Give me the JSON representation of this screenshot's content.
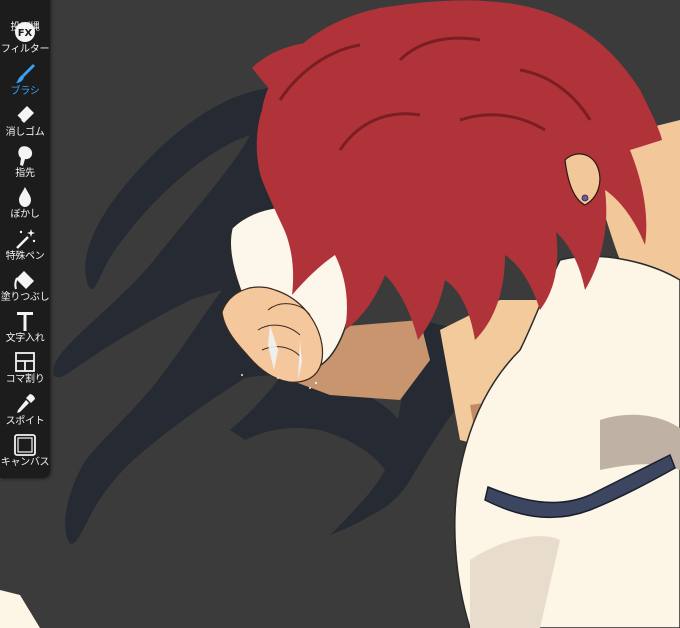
{
  "toolbar": {
    "tools": [
      {
        "label": "投げ縄",
        "icon": "lasso-icon",
        "active": false
      },
      {
        "label": "フィルター",
        "icon": "fx-filter-icon",
        "icon_text": "FX",
        "active": false
      },
      {
        "label": "ブラシ",
        "icon": "brush-icon",
        "active": true
      },
      {
        "label": "消しゴム",
        "icon": "eraser-icon",
        "active": false
      },
      {
        "label": "指先",
        "icon": "smudge-finger-icon",
        "active": false
      },
      {
        "label": "ぼかし",
        "icon": "blur-drop-icon",
        "active": false
      },
      {
        "label": "特殊ペン",
        "icon": "special-pen-icon",
        "active": false
      },
      {
        "label": "塗りつぶし",
        "icon": "fill-bucket-icon",
        "active": false
      },
      {
        "label": "文字入れ",
        "icon": "text-icon",
        "active": false
      },
      {
        "label": "コマ割り",
        "icon": "panel-divide-icon",
        "active": false
      },
      {
        "label": "スポイト",
        "icon": "eyedropper-icon",
        "active": false
      },
      {
        "label": "キャンバス",
        "icon": "canvas-icon",
        "active": false
      }
    ],
    "active_color": "#3aa0f4",
    "label_color": "#f2f2f2",
    "background": "#1c1c1c"
  },
  "canvas": {
    "background": "#3b3b3b",
    "artwork": "anime-illustration-red-haired-figure"
  }
}
